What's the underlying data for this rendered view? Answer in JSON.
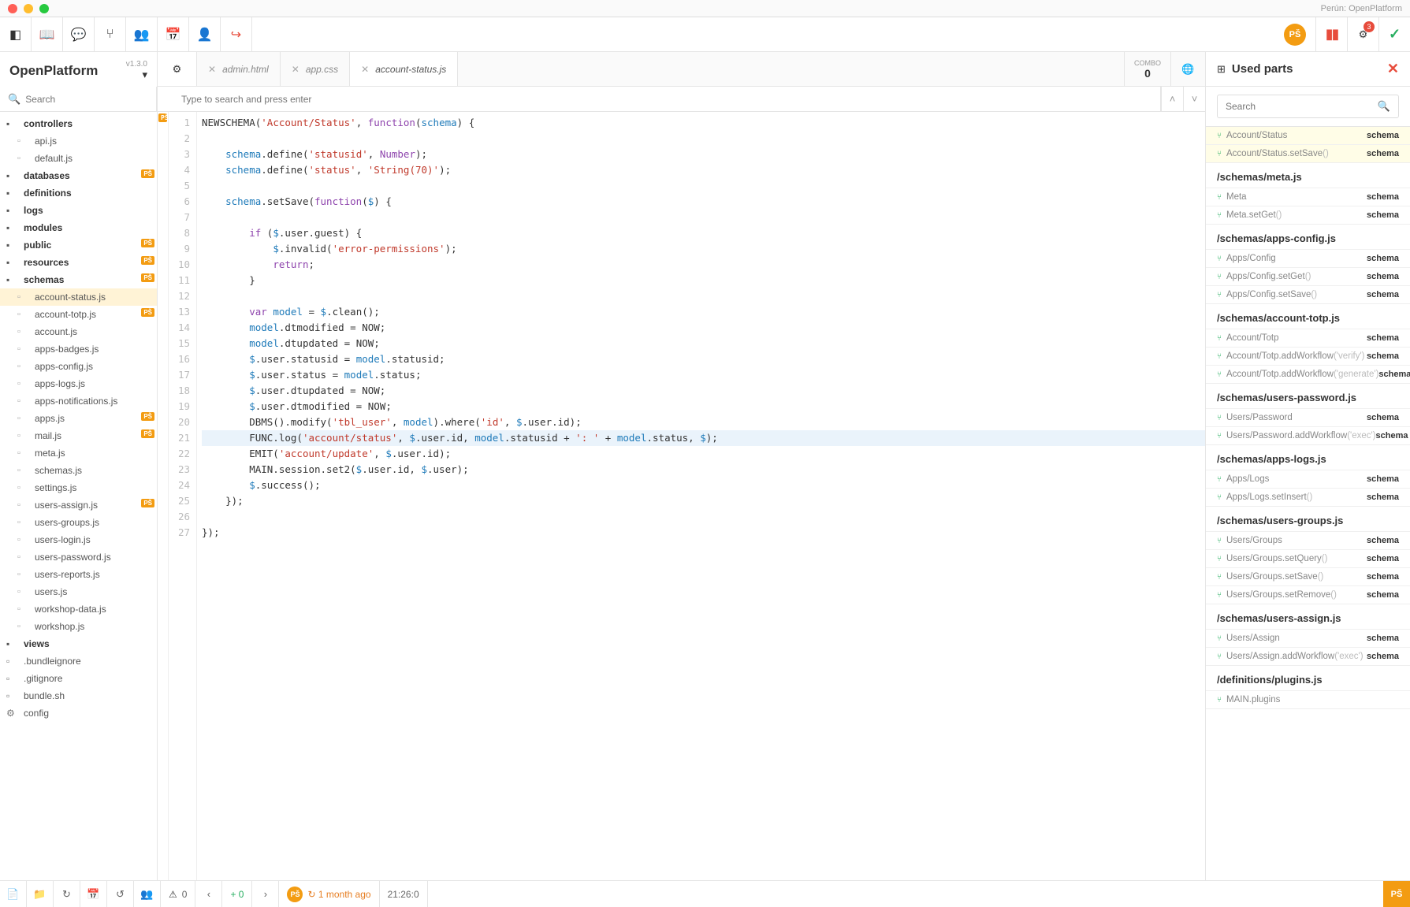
{
  "chrome": {
    "title": "Perún: OpenPlatform"
  },
  "user_initials": "PŠ",
  "toolbar": {
    "badge": "3"
  },
  "project": {
    "name": "OpenPlatform",
    "version": "v1.3.0"
  },
  "tree": {
    "search_placeholder": "Search",
    "nodes": [
      {
        "t": "folder",
        "label": "controllers"
      },
      {
        "t": "file",
        "label": "api.js"
      },
      {
        "t": "file",
        "label": "default.js"
      },
      {
        "t": "folder",
        "label": "databases",
        "marker": true
      },
      {
        "t": "folder",
        "label": "definitions"
      },
      {
        "t": "folder",
        "label": "logs"
      },
      {
        "t": "folder",
        "label": "modules"
      },
      {
        "t": "folder",
        "label": "public",
        "marker": true
      },
      {
        "t": "folder",
        "label": "resources",
        "marker": true
      },
      {
        "t": "folder",
        "label": "schemas",
        "marker": true
      },
      {
        "t": "file",
        "label": "account-status.js",
        "active": true
      },
      {
        "t": "file",
        "label": "account-totp.js",
        "marker": true
      },
      {
        "t": "file",
        "label": "account.js"
      },
      {
        "t": "file",
        "label": "apps-badges.js"
      },
      {
        "t": "file",
        "label": "apps-config.js"
      },
      {
        "t": "file",
        "label": "apps-logs.js"
      },
      {
        "t": "file",
        "label": "apps-notifications.js"
      },
      {
        "t": "file",
        "label": "apps.js",
        "marker": true
      },
      {
        "t": "file",
        "label": "mail.js",
        "marker": true
      },
      {
        "t": "file",
        "label": "meta.js"
      },
      {
        "t": "file",
        "label": "schemas.js"
      },
      {
        "t": "file",
        "label": "settings.js"
      },
      {
        "t": "file",
        "label": "users-assign.js",
        "marker": true
      },
      {
        "t": "file",
        "label": "users-groups.js"
      },
      {
        "t": "file",
        "label": "users-login.js"
      },
      {
        "t": "file",
        "label": "users-password.js"
      },
      {
        "t": "file",
        "label": "users-reports.js"
      },
      {
        "t": "file",
        "label": "users.js"
      },
      {
        "t": "file",
        "label": "workshop-data.js"
      },
      {
        "t": "file",
        "label": "workshop.js"
      },
      {
        "t": "folder",
        "label": "views"
      },
      {
        "t": "root-file",
        "label": ".bundleignore"
      },
      {
        "t": "root-file",
        "label": ".gitignore"
      },
      {
        "t": "root-file",
        "label": "bundle.sh"
      },
      {
        "t": "root-file",
        "label": "config",
        "cog": true
      }
    ]
  },
  "tabs": [
    {
      "label": "admin.html"
    },
    {
      "label": "app.css"
    },
    {
      "label": "account-status.js",
      "active": true
    }
  ],
  "combo": {
    "label": "COMBO",
    "value": "0"
  },
  "editor_search_placeholder": "Type to search and press enter",
  "code": [
    {
      "n": 1,
      "html": "NEWSCHEMA(<span class='k-str'>'Account/Status'</span>, <span class='k-kw'>function</span>(<span class='k-def'>schema</span>) {"
    },
    {
      "n": 2,
      "html": ""
    },
    {
      "n": 3,
      "html": "    <span class='k-def'>schema</span>.define(<span class='k-str'>'statusid'</span>, <span class='k-type'>Number</span>);"
    },
    {
      "n": 4,
      "html": "    <span class='k-def'>schema</span>.define(<span class='k-str'>'status'</span>, <span class='k-str'>'String(70)'</span>);"
    },
    {
      "n": 5,
      "html": ""
    },
    {
      "n": 6,
      "html": "    <span class='k-def'>schema</span>.setSave(<span class='k-kw'>function</span>(<span class='k-def'>$</span>) {"
    },
    {
      "n": 7,
      "html": ""
    },
    {
      "n": 8,
      "html": "        <span class='k-kw'>if</span> (<span class='k-def'>$</span>.user.guest) {"
    },
    {
      "n": 9,
      "html": "            <span class='k-def'>$</span>.invalid(<span class='k-str'>'error-permissions'</span>);"
    },
    {
      "n": 10,
      "html": "            <span class='k-kw'>return</span>;"
    },
    {
      "n": 11,
      "html": "        }"
    },
    {
      "n": 12,
      "html": ""
    },
    {
      "n": 13,
      "html": "        <span class='k-kw'>var</span> <span class='k-def'>model</span> = <span class='k-def'>$</span>.clean();"
    },
    {
      "n": 14,
      "html": "        <span class='k-def'>model</span>.dtmodified = NOW;"
    },
    {
      "n": 15,
      "html": "        <span class='k-def'>model</span>.dtupdated = NOW;"
    },
    {
      "n": 16,
      "html": "        <span class='k-def'>$</span>.user.statusid = <span class='k-def'>model</span>.statusid;"
    },
    {
      "n": 17,
      "html": "        <span class='k-def'>$</span>.user.status = <span class='k-def'>model</span>.status;"
    },
    {
      "n": 18,
      "html": "        <span class='k-def'>$</span>.user.dtupdated = NOW;"
    },
    {
      "n": 19,
      "html": "        <span class='k-def'>$</span>.user.dtmodified = NOW;"
    },
    {
      "n": 20,
      "html": "        DBMS().modify(<span class='k-str'>'tbl_user'</span>, <span class='k-def'>model</span>).where(<span class='k-str'>'id'</span>, <span class='k-def'>$</span>.user.id);"
    },
    {
      "n": 21,
      "html": "        FUNC.log(<span class='k-str'>'account/status'</span>, <span class='k-def'>$</span>.user.id, <span class='k-def'>model</span>.statusid + <span class='k-str'>': '</span> + <span class='k-def'>model</span>.status, <span class='k-def'>$</span>);",
      "hl": true
    },
    {
      "n": 22,
      "html": "        EMIT(<span class='k-str'>'account/update'</span>, <span class='k-def'>$</span>.user.id);"
    },
    {
      "n": 23,
      "html": "        MAIN.session.set2(<span class='k-def'>$</span>.user.id, <span class='k-def'>$</span>.user);"
    },
    {
      "n": 24,
      "html": "        <span class='k-def'>$</span>.success();"
    },
    {
      "n": 25,
      "html": "    });"
    },
    {
      "n": 26,
      "html": ""
    },
    {
      "n": 27,
      "html": "});"
    }
  ],
  "panel": {
    "title": "Used parts",
    "search_placeholder": "Search",
    "groups": [
      {
        "hl": true,
        "items": [
          {
            "name": "Account/Status",
            "type": "schema"
          },
          {
            "name": "Account/Status.setSave",
            "extra": "()",
            "type": "schema"
          }
        ]
      },
      {
        "title": "/schemas/meta.js",
        "items": [
          {
            "name": "Meta",
            "type": "schema"
          },
          {
            "name": "Meta.setGet",
            "extra": "()",
            "type": "schema"
          }
        ]
      },
      {
        "title": "/schemas/apps-config.js",
        "items": [
          {
            "name": "Apps/Config",
            "type": "schema"
          },
          {
            "name": "Apps/Config.setGet",
            "extra": "()",
            "type": "schema"
          },
          {
            "name": "Apps/Config.setSave",
            "extra": "()",
            "type": "schema"
          }
        ]
      },
      {
        "title": "/schemas/account-totp.js",
        "items": [
          {
            "name": "Account/Totp",
            "type": "schema"
          },
          {
            "name": "Account/Totp.addWorkflow",
            "extra": "('verify')",
            "type": "schema"
          },
          {
            "name": "Account/Totp.addWorkflow",
            "extra": "('generate')",
            "type": "schema"
          }
        ]
      },
      {
        "title": "/schemas/users-password.js",
        "items": [
          {
            "name": "Users/Password",
            "type": "schema"
          },
          {
            "name": "Users/Password.addWorkflow",
            "extra": "('exec')",
            "type": "schema"
          }
        ]
      },
      {
        "title": "/schemas/apps-logs.js",
        "items": [
          {
            "name": "Apps/Logs",
            "type": "schema"
          },
          {
            "name": "Apps/Logs.setInsert",
            "extra": "()",
            "type": "schema"
          }
        ]
      },
      {
        "title": "/schemas/users-groups.js",
        "items": [
          {
            "name": "Users/Groups",
            "type": "schema"
          },
          {
            "name": "Users/Groups.setQuery",
            "extra": "()",
            "type": "schema"
          },
          {
            "name": "Users/Groups.setSave",
            "extra": "()",
            "type": "schema"
          },
          {
            "name": "Users/Groups.setRemove",
            "extra": "()",
            "type": "schema"
          }
        ]
      },
      {
        "title": "/schemas/users-assign.js",
        "items": [
          {
            "name": "Users/Assign",
            "type": "schema"
          },
          {
            "name": "Users/Assign.addWorkflow",
            "extra": "('exec')",
            "type": "schema"
          }
        ]
      },
      {
        "title": "/definitions/plugins.js",
        "items": [
          {
            "name": "MAIN.plugins",
            "type": ""
          }
        ]
      }
    ]
  },
  "status": {
    "warnings": "0",
    "additions": "+ 0",
    "time_ago": "1 month ago",
    "cursor": "21:26:0"
  }
}
